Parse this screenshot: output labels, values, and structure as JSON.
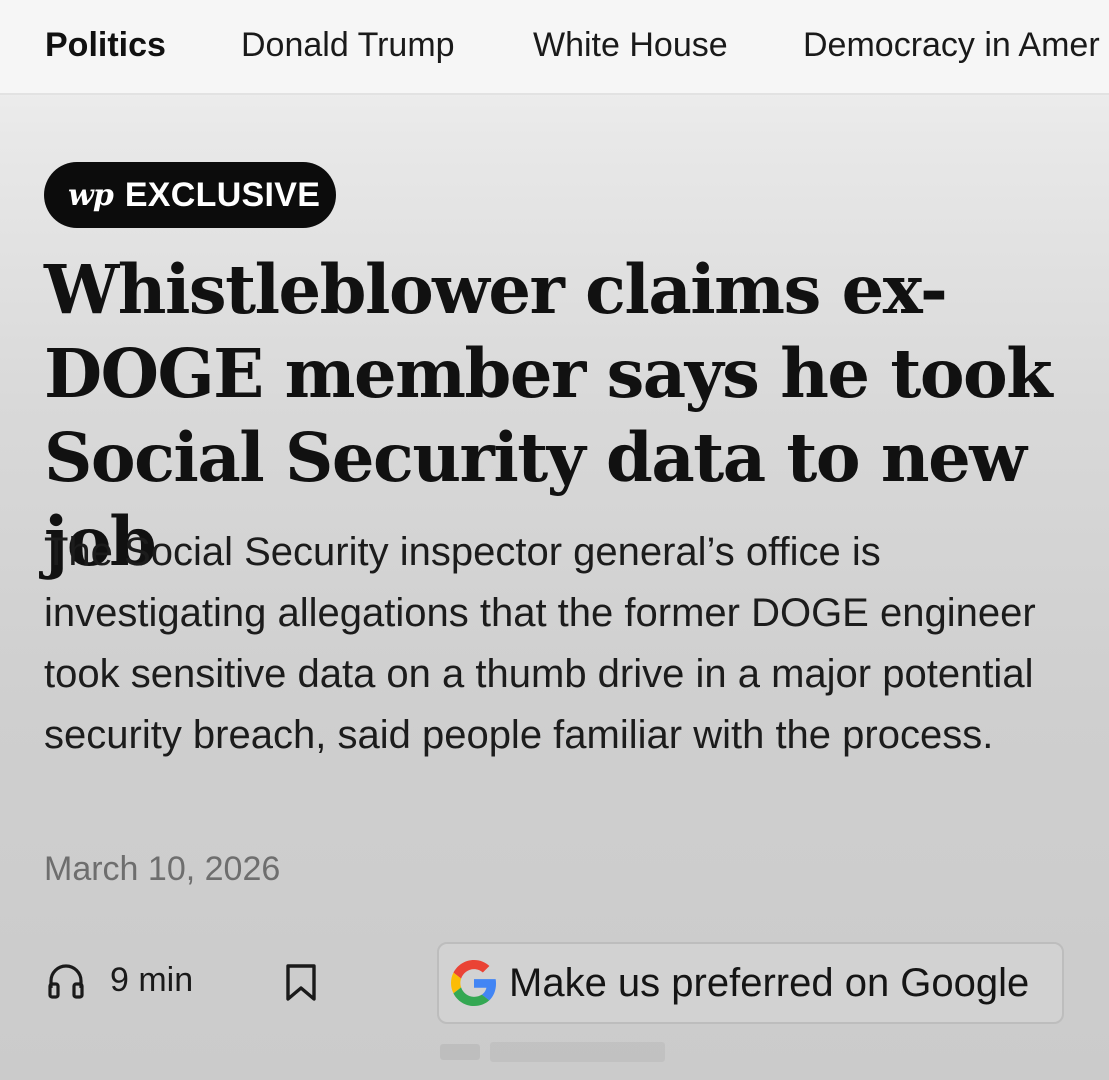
{
  "nav": {
    "items": [
      {
        "label": "Politics",
        "active": true
      },
      {
        "label": "Donald Trump"
      },
      {
        "label": "White House"
      },
      {
        "label": "Democracy in Amer"
      }
    ]
  },
  "badge": {
    "logo": "wp",
    "label": "EXCLUSIVE",
    "background": "#0c0c0c"
  },
  "article": {
    "headline": "Whistleblower claims ex-DOGE member says he took Social Security data to new job",
    "dek": "The Social Security inspector general’s office is investigating allegations that the former DOGE engineer took sensitive data on a thumb drive in a major potential security breach, said people familiar with the process.",
    "date": "March 10, 2026"
  },
  "actions": {
    "listen": {
      "icon": "headphones-icon",
      "label": "9 min"
    },
    "bookmark": {
      "icon": "bookmark-icon"
    },
    "google_button": {
      "icon": "google-g-icon",
      "label": "Make us preferred on Google"
    }
  }
}
